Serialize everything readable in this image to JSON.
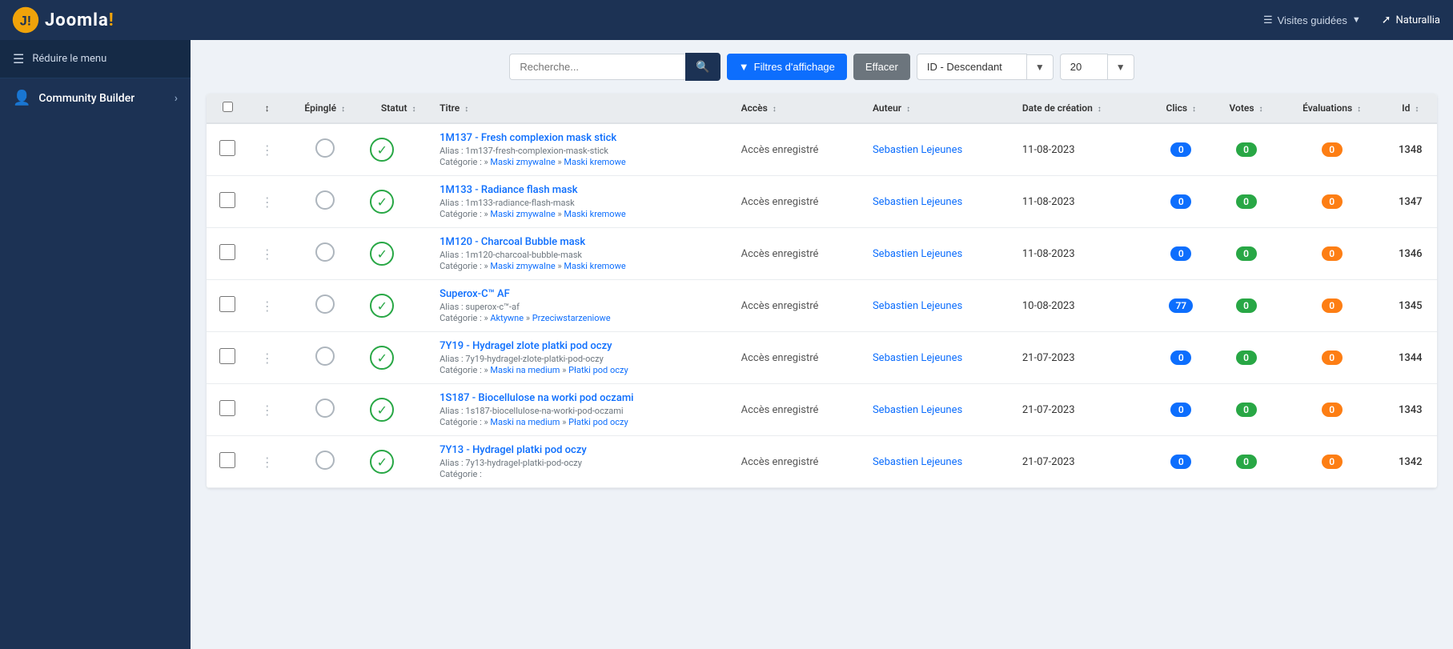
{
  "sidebar": {
    "logo_text": "Joomla!",
    "reduce_label": "Réduire le menu",
    "community_builder_label": "Community Builder"
  },
  "topbar": {
    "guided_visits_label": "Visites guidées",
    "user_label": "Naturallia"
  },
  "toolbar": {
    "search_placeholder": "Recherche...",
    "filters_label": "Filtres d'affichage",
    "clear_label": "Effacer",
    "sort_value": "ID - Descendant",
    "per_page_value": "20"
  },
  "table": {
    "columns": {
      "pin": "Épinglé",
      "status": "Statut",
      "title": "Titre",
      "access": "Accès",
      "author": "Auteur",
      "created": "Date de création",
      "clicks": "Clics",
      "votes": "Votes",
      "evaluations": "Évaluations",
      "id": "Id"
    },
    "rows": [
      {
        "id": "1348",
        "title": "1M137 - Fresh complexion mask stick",
        "alias": "Alias : 1m137-fresh-complexion-mask-stick",
        "cat_prefix": "Catégorie : »",
        "cat1": "Maski zmywalne",
        "cat2": "Maski kremowe",
        "access": "Accès enregistré",
        "author": "Sebastien Lejeunes",
        "created": "11-08-2023",
        "clicks": "0",
        "votes": "0",
        "evaluations": "0",
        "clicks_color": "blue",
        "votes_color": "green",
        "eval_color": "orange"
      },
      {
        "id": "1347",
        "title": "1M133 - Radiance flash mask",
        "alias": "Alias : 1m133-radiance-flash-mask",
        "cat_prefix": "Catégorie : »",
        "cat1": "Maski zmywalne",
        "cat2": "Maski kremowe",
        "access": "Accès enregistré",
        "author": "Sebastien Lejeunes",
        "created": "11-08-2023",
        "clicks": "0",
        "votes": "0",
        "evaluations": "0",
        "clicks_color": "blue",
        "votes_color": "green",
        "eval_color": "orange"
      },
      {
        "id": "1346",
        "title": "1M120 - Charcoal Bubble mask",
        "alias": "Alias : 1m120-charcoal-bubble-mask",
        "cat_prefix": "Catégorie : »",
        "cat1": "Maski zmywalne",
        "cat2": "Maski kremowe",
        "access": "Accès enregistré",
        "author": "Sebastien Lejeunes",
        "created": "11-08-2023",
        "clicks": "0",
        "votes": "0",
        "evaluations": "0",
        "clicks_color": "blue",
        "votes_color": "green",
        "eval_color": "orange"
      },
      {
        "id": "1345",
        "title": "Superox-C™ AF",
        "alias": "Alias : superox-c™-af",
        "cat_prefix": "Catégorie : »",
        "cat1": "Aktywne",
        "cat2": "Przeciwstarzeniowe",
        "access": "Accès enregistré",
        "author": "Sebastien Lejeunes",
        "created": "10-08-2023",
        "clicks": "77",
        "votes": "0",
        "evaluations": "0",
        "clicks_color": "blue",
        "votes_color": "green",
        "eval_color": "orange"
      },
      {
        "id": "1344",
        "title": "7Y19 - Hydragel zlote platki pod oczy",
        "alias": "Alias : 7y19-hydragel-zlote-platki-pod-oczy",
        "cat_prefix": "Catégorie : »",
        "cat1": "Maski na medium",
        "cat2": "Płatki pod oczy",
        "access": "Accès enregistré",
        "author": "Sebastien Lejeunes",
        "created": "21-07-2023",
        "clicks": "0",
        "votes": "0",
        "evaluations": "0",
        "clicks_color": "blue",
        "votes_color": "green",
        "eval_color": "orange"
      },
      {
        "id": "1343",
        "title": "1S187 - Biocellulose na worki pod oczami",
        "alias": "Alias : 1s187-biocellulose-na-worki-pod-oczami",
        "cat_prefix": "Catégorie : »",
        "cat1": "Maski na medium",
        "cat2": "Płatki pod oczy",
        "access": "Accès enregistré",
        "author": "Sebastien Lejeunes",
        "created": "21-07-2023",
        "clicks": "0",
        "votes": "0",
        "evaluations": "0",
        "clicks_color": "blue",
        "votes_color": "green",
        "eval_color": "orange"
      },
      {
        "id": "1342",
        "title": "7Y13 - Hydragel platki pod oczy",
        "alias": "Alias : 7y13-hydragel-platki-pod-oczy",
        "cat_prefix": "Catégorie : »",
        "cat1": "",
        "cat2": "",
        "access": "Accès enregistré",
        "author": "Sebastien Lejeunes",
        "created": "21-07-2023",
        "clicks": "0",
        "votes": "0",
        "evaluations": "0",
        "clicks_color": "blue",
        "votes_color": "green",
        "eval_color": "orange"
      }
    ]
  }
}
